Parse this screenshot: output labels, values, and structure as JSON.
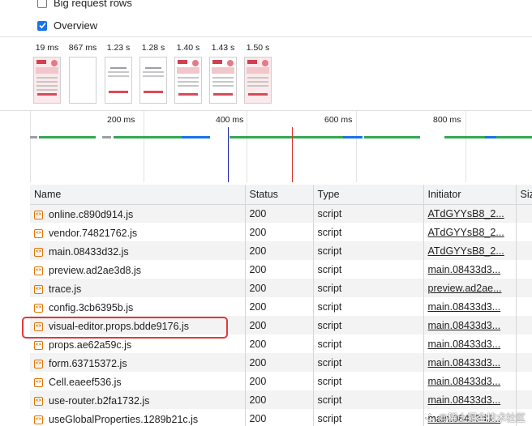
{
  "options": {
    "big_request_rows": {
      "label": "Big request rows",
      "checked": false
    },
    "overview": {
      "label": "Overview",
      "checked": true
    }
  },
  "filmstrip": [
    {
      "time": "19 ms"
    },
    {
      "time": "867 ms"
    },
    {
      "time": "1.23 s"
    },
    {
      "time": "1.28 s"
    },
    {
      "time": "1.40 s"
    },
    {
      "time": "1.43 s"
    },
    {
      "time": "1.50 s"
    }
  ],
  "overview_ticks": [
    "200 ms",
    "400 ms",
    "600 ms",
    "800 ms"
  ],
  "colors": {
    "waiting": "#34a853",
    "download": "#1a73e8",
    "domcontentloaded": "#1a1aa6",
    "load": "#d93025",
    "highlight": "#e0393b"
  },
  "table": {
    "headers": [
      "Name",
      "Status",
      "Type",
      "Initiator",
      "Size"
    ],
    "rows": [
      {
        "name": "online.c890d914.js",
        "status": "200",
        "type": "script",
        "initiator": "ATdGYYsB8_2..."
      },
      {
        "name": "vendor.74821762.js",
        "status": "200",
        "type": "script",
        "initiator": "ATdGYYsB8_2..."
      },
      {
        "name": "main.08433d32.js",
        "status": "200",
        "type": "script",
        "initiator": "ATdGYYsB8_2..."
      },
      {
        "name": "preview.ad2ae3d8.js",
        "status": "200",
        "type": "script",
        "initiator": "main.08433d3..."
      },
      {
        "name": "trace.js",
        "status": "200",
        "type": "script",
        "initiator": "preview.ad2ae..."
      },
      {
        "name": "config.3cb6395b.js",
        "status": "200",
        "type": "script",
        "initiator": "main.08433d3..."
      },
      {
        "name": "visual-editor.props.bdde9176.js",
        "status": "200",
        "type": "script",
        "initiator": "main.08433d3..."
      },
      {
        "name": "props.ae62a59c.js",
        "status": "200",
        "type": "script",
        "initiator": "main.08433d3..."
      },
      {
        "name": "form.63715372.js",
        "status": "200",
        "type": "script",
        "initiator": "main.08433d3..."
      },
      {
        "name": "Cell.eaeef536.js",
        "status": "200",
        "type": "script",
        "initiator": "main.08433d3..."
      },
      {
        "name": "use-router.b2fa1732.js",
        "status": "200",
        "type": "script",
        "initiator": "main.08433d3..."
      },
      {
        "name": "useGlobalProperties.1289b21c.js",
        "status": "200",
        "type": "script",
        "initiator": "main.08433d3..."
      }
    ]
  },
  "watermark": "@稀土掘金技术社区"
}
